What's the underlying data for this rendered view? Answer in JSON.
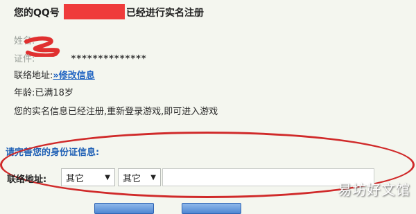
{
  "header": {
    "prefix": "您的QQ号",
    "suffix": "已经进行实名注册"
  },
  "info": {
    "name_label": "姓名:",
    "id_label": "证件:",
    "id_masked": "**************",
    "contact_label": "联络地址:",
    "edit_link": "»修改信息",
    "age_line": "年龄:已满18岁",
    "notice": "您的实名信息已经注册,重新登录游戏,即可进入游戏"
  },
  "form": {
    "title": "请完善您的身份证信息:",
    "address_label": "联络地址:",
    "select_province": "其它",
    "select_city": "其它",
    "address_value": ""
  },
  "watermark": "易坊好文馆",
  "colors": {
    "redaction": "#ef3b3b",
    "link": "#1f63c2",
    "annotation": "#d02a2a",
    "button": "#4f87d3"
  }
}
